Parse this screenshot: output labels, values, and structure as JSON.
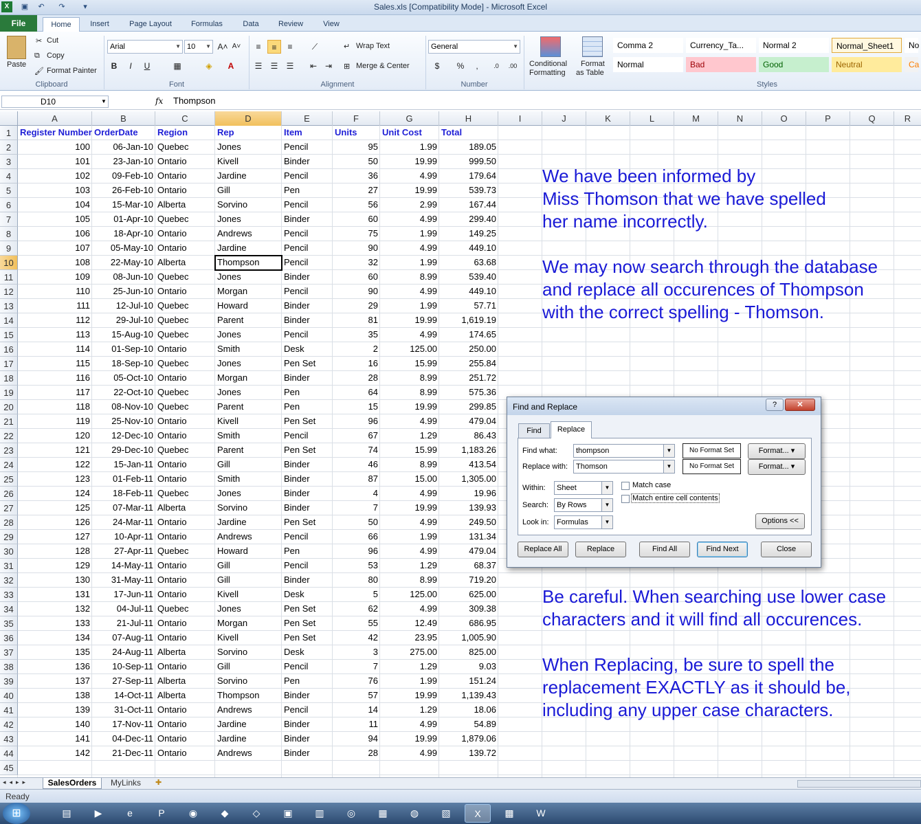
{
  "window": {
    "title": "Sales.xls  [Compatibility Mode]  -  Microsoft Excel"
  },
  "ribbon_tabs": [
    "File",
    "Home",
    "Insert",
    "Page Layout",
    "Formulas",
    "Data",
    "Review",
    "View"
  ],
  "clipboard": {
    "paste": "Paste",
    "cut": "Cut",
    "copy": "Copy",
    "format_painter": "Format Painter",
    "label": "Clipboard"
  },
  "font": {
    "name": "Arial",
    "size": "10",
    "bold": "B",
    "italic": "I",
    "underline": "U",
    "label": "Font"
  },
  "alignment": {
    "wrap": "Wrap Text",
    "merge": "Merge & Center",
    "label": "Alignment"
  },
  "number": {
    "format": "General",
    "label": "Number"
  },
  "styles_group": {
    "conditional": "Conditional",
    "formatting": "Formatting",
    "format_as": "Format",
    "as_table": "as Table",
    "label": "Styles",
    "cells": [
      {
        "text": "Comma 2",
        "bg": "#ffffff",
        "fg": "#000000"
      },
      {
        "text": "Currency_Ta...",
        "bg": "#ffffff",
        "fg": "#000000"
      },
      {
        "text": "Normal 2",
        "bg": "#ffffff",
        "fg": "#000000"
      },
      {
        "text": "Normal_Sheet1",
        "bg": "#ffffff",
        "fg": "#000000"
      },
      {
        "text": "No",
        "bg": "#ffffff",
        "fg": "#000000"
      },
      {
        "text": "Normal",
        "bg": "#ffffff",
        "fg": "#000000"
      },
      {
        "text": "Bad",
        "bg": "#ffc7ce",
        "fg": "#9c0006"
      },
      {
        "text": "Good",
        "bg": "#c6efce",
        "fg": "#006100"
      },
      {
        "text": "Neutral",
        "bg": "#ffeb9c",
        "fg": "#9c6500"
      },
      {
        "text": "Ca",
        "bg": "#f2f2f2",
        "fg": "#fa7d00"
      }
    ]
  },
  "formula_bar": {
    "name_box": "D10",
    "fx": "fx",
    "value": "Thompson"
  },
  "columns": [
    "A",
    "B",
    "C",
    "D",
    "E",
    "F",
    "G",
    "H",
    "I",
    "J",
    "K",
    "L",
    "M",
    "N",
    "O",
    "P",
    "Q",
    "R"
  ],
  "headers": [
    "Register Number",
    "OrderDate",
    "Region",
    "Rep",
    "Item",
    "Units",
    "Unit Cost",
    "Total"
  ],
  "rows": [
    [
      "100",
      "06-Jan-10",
      "Quebec",
      "Jones",
      "Pencil",
      "95",
      "1.99",
      "189.05"
    ],
    [
      "101",
      "23-Jan-10",
      "Ontario",
      "Kivell",
      "Binder",
      "50",
      "19.99",
      "999.50"
    ],
    [
      "102",
      "09-Feb-10",
      "Ontario",
      "Jardine",
      "Pencil",
      "36",
      "4.99",
      "179.64"
    ],
    [
      "103",
      "26-Feb-10",
      "Ontario",
      "Gill",
      "Pen",
      "27",
      "19.99",
      "539.73"
    ],
    [
      "104",
      "15-Mar-10",
      "Alberta",
      "Sorvino",
      "Pencil",
      "56",
      "2.99",
      "167.44"
    ],
    [
      "105",
      "01-Apr-10",
      "Quebec",
      "Jones",
      "Binder",
      "60",
      "4.99",
      "299.40"
    ],
    [
      "106",
      "18-Apr-10",
      "Ontario",
      "Andrews",
      "Pencil",
      "75",
      "1.99",
      "149.25"
    ],
    [
      "107",
      "05-May-10",
      "Ontario",
      "Jardine",
      "Pencil",
      "90",
      "4.99",
      "449.10"
    ],
    [
      "108",
      "22-May-10",
      "Alberta",
      "Thompson",
      "Pencil",
      "32",
      "1.99",
      "63.68"
    ],
    [
      "109",
      "08-Jun-10",
      "Quebec",
      "Jones",
      "Binder",
      "60",
      "8.99",
      "539.40"
    ],
    [
      "110",
      "25-Jun-10",
      "Ontario",
      "Morgan",
      "Pencil",
      "90",
      "4.99",
      "449.10"
    ],
    [
      "111",
      "12-Jul-10",
      "Quebec",
      "Howard",
      "Binder",
      "29",
      "1.99",
      "57.71"
    ],
    [
      "112",
      "29-Jul-10",
      "Quebec",
      "Parent",
      "Binder",
      "81",
      "19.99",
      "1,619.19"
    ],
    [
      "113",
      "15-Aug-10",
      "Quebec",
      "Jones",
      "Pencil",
      "35",
      "4.99",
      "174.65"
    ],
    [
      "114",
      "01-Sep-10",
      "Ontario",
      "Smith",
      "Desk",
      "2",
      "125.00",
      "250.00"
    ],
    [
      "115",
      "18-Sep-10",
      "Quebec",
      "Jones",
      "Pen Set",
      "16",
      "15.99",
      "255.84"
    ],
    [
      "116",
      "05-Oct-10",
      "Ontario",
      "Morgan",
      "Binder",
      "28",
      "8.99",
      "251.72"
    ],
    [
      "117",
      "22-Oct-10",
      "Quebec",
      "Jones",
      "Pen",
      "64",
      "8.99",
      "575.36"
    ],
    [
      "118",
      "08-Nov-10",
      "Quebec",
      "Parent",
      "Pen",
      "15",
      "19.99",
      "299.85"
    ],
    [
      "119",
      "25-Nov-10",
      "Ontario",
      "Kivell",
      "Pen Set",
      "96",
      "4.99",
      "479.04"
    ],
    [
      "120",
      "12-Dec-10",
      "Ontario",
      "Smith",
      "Pencil",
      "67",
      "1.29",
      "86.43"
    ],
    [
      "121",
      "29-Dec-10",
      "Quebec",
      "Parent",
      "Pen Set",
      "74",
      "15.99",
      "1,183.26"
    ],
    [
      "122",
      "15-Jan-11",
      "Ontario",
      "Gill",
      "Binder",
      "46",
      "8.99",
      "413.54"
    ],
    [
      "123",
      "01-Feb-11",
      "Ontario",
      "Smith",
      "Binder",
      "87",
      "15.00",
      "1,305.00"
    ],
    [
      "124",
      "18-Feb-11",
      "Quebec",
      "Jones",
      "Binder",
      "4",
      "4.99",
      "19.96"
    ],
    [
      "125",
      "07-Mar-11",
      "Alberta",
      "Sorvino",
      "Binder",
      "7",
      "19.99",
      "139.93"
    ],
    [
      "126",
      "24-Mar-11",
      "Ontario",
      "Jardine",
      "Pen Set",
      "50",
      "4.99",
      "249.50"
    ],
    [
      "127",
      "10-Apr-11",
      "Ontario",
      "Andrews",
      "Pencil",
      "66",
      "1.99",
      "131.34"
    ],
    [
      "128",
      "27-Apr-11",
      "Quebec",
      "Howard",
      "Pen",
      "96",
      "4.99",
      "479.04"
    ],
    [
      "129",
      "14-May-11",
      "Ontario",
      "Gill",
      "Pencil",
      "53",
      "1.29",
      "68.37"
    ],
    [
      "130",
      "31-May-11",
      "Ontario",
      "Gill",
      "Binder",
      "80",
      "8.99",
      "719.20"
    ],
    [
      "131",
      "17-Jun-11",
      "Ontario",
      "Kivell",
      "Desk",
      "5",
      "125.00",
      "625.00"
    ],
    [
      "132",
      "04-Jul-11",
      "Quebec",
      "Jones",
      "Pen Set",
      "62",
      "4.99",
      "309.38"
    ],
    [
      "133",
      "21-Jul-11",
      "Ontario",
      "Morgan",
      "Pen Set",
      "55",
      "12.49",
      "686.95"
    ],
    [
      "134",
      "07-Aug-11",
      "Ontario",
      "Kivell",
      "Pen Set",
      "42",
      "23.95",
      "1,005.90"
    ],
    [
      "135",
      "24-Aug-11",
      "Alberta",
      "Sorvino",
      "Desk",
      "3",
      "275.00",
      "825.00"
    ],
    [
      "136",
      "10-Sep-11",
      "Ontario",
      "Gill",
      "Pencil",
      "7",
      "1.29",
      "9.03"
    ],
    [
      "137",
      "27-Sep-11",
      "Alberta",
      "Sorvino",
      "Pen",
      "76",
      "1.99",
      "151.24"
    ],
    [
      "138",
      "14-Oct-11",
      "Alberta",
      "Thompson",
      "Binder",
      "57",
      "19.99",
      "1,139.43"
    ],
    [
      "139",
      "31-Oct-11",
      "Ontario",
      "Andrews",
      "Pencil",
      "14",
      "1.29",
      "18.06"
    ],
    [
      "140",
      "17-Nov-11",
      "Ontario",
      "Jardine",
      "Binder",
      "11",
      "4.99",
      "54.89"
    ],
    [
      "141",
      "04-Dec-11",
      "Ontario",
      "Jardine",
      "Binder",
      "94",
      "19.99",
      "1,879.06"
    ],
    [
      "142",
      "21-Dec-11",
      "Ontario",
      "Andrews",
      "Binder",
      "28",
      "4.99",
      "139.72"
    ]
  ],
  "notes": {
    "p1": [
      "We have been informed by",
      "Miss Thomson that we have spelled",
      "her name incorrectly."
    ],
    "p2": [
      "We may now search through the database",
      "and replace all occurences of Thompson",
      "with the correct spelling - Thomson."
    ],
    "p3": [
      "Be careful. When searching use lower case",
      "characters and it will find all occurences."
    ],
    "p4": [
      "When Replacing, be sure to spell the",
      "replacement EXACTLY as it should be,",
      "including any upper case characters."
    ]
  },
  "dialog": {
    "title": "Find and Replace",
    "help": "?",
    "close": "✕",
    "tab_find": "Find",
    "tab_replace": "Replace",
    "find_label": "Find what:",
    "find_value": "thompson",
    "replace_label": "Replace with:",
    "replace_value": "Thomson",
    "no_format": "No Format Set",
    "format_btn": "Format...",
    "within_label": "Within:",
    "within_value": "Sheet",
    "search_label": "Search:",
    "search_value": "By Rows",
    "lookin_label": "Look in:",
    "lookin_value": "Formulas",
    "match_case": "Match case",
    "match_entire": "Match entire cell contents",
    "options_btn": "Options <<",
    "replace_all": "Replace All",
    "replace": "Replace",
    "find_all": "Find All",
    "find_next": "Find Next",
    "close_btn": "Close"
  },
  "sheet_tabs": [
    "SalesOrders",
    "MyLinks"
  ],
  "status": {
    "text": "Ready"
  }
}
